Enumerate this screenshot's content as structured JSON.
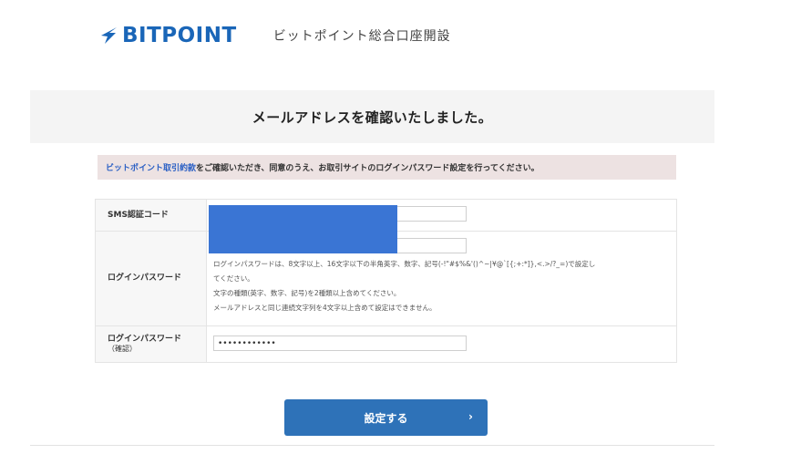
{
  "header": {
    "logo_text": "BITPOINT",
    "title": "ビットポイント総合口座開設",
    "brand_color": "#1a66b8"
  },
  "banner": {
    "text": "メールアドレスを確認いたしました。"
  },
  "notice": {
    "link_text": "ビットポイント取引約款",
    "rest_text": "をご確認いただき、同意のうえ、お取引サイトのログインパスワード設定を行ってください。"
  },
  "form": {
    "sms": {
      "label": "SMS認証コード",
      "value": "",
      "placeholder": ""
    },
    "password": {
      "label": "ログインパスワード",
      "value": "",
      "hints": [
        "ログインパスワードは、8文字以上、16文字以下の半角英字、数字、記号(-!\"#$%&'()^~|¥@`[{;+:*]},<.>/?_=)で設定し",
        "てください。",
        "文字の種類(英字、数字、記号)を2種類以上含めてください。",
        "メールアドレスと同じ連続文字列を4文字以上含めて設定はできません。"
      ]
    },
    "password_confirm": {
      "label": "ログインパスワード",
      "label_sub": "（確認）",
      "value": "••••••••••••"
    }
  },
  "submit": {
    "label": "設定する",
    "arrow": "›",
    "color": "#2e72b8"
  },
  "redaction_color": "#3a75d4"
}
